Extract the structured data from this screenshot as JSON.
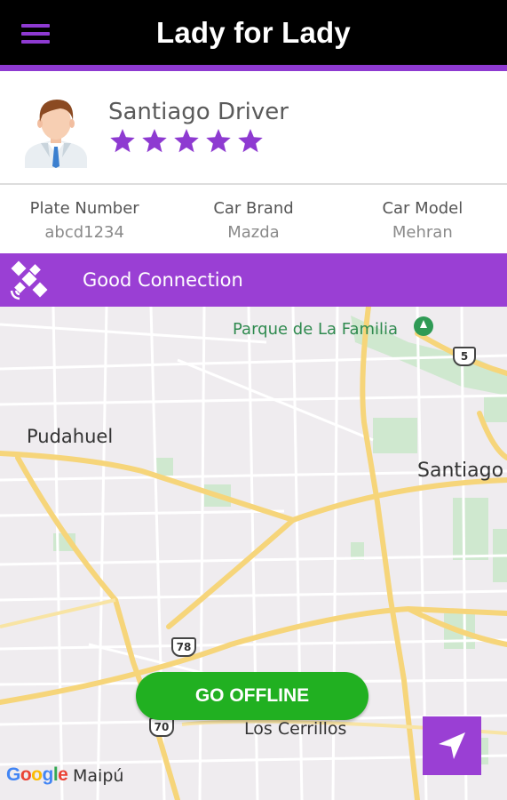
{
  "header": {
    "title": "Lady for Lady",
    "menu_icon": "hamburger-menu-icon"
  },
  "driver": {
    "name": "Santiago Driver",
    "rating": 5,
    "rating_max": 5,
    "avatar_icon": "driver-avatar"
  },
  "vehicle": {
    "plate_label": "Plate Number",
    "plate_value": "abcd1234",
    "brand_label": "Car Brand",
    "brand_value": "Mazda",
    "model_label": "Car Model",
    "model_value": "Mehran"
  },
  "connection": {
    "status": "Good Connection",
    "icon": "satellite-icon"
  },
  "map": {
    "labels": {
      "parque": "Parque de La Familia",
      "pudahuel": "Pudahuel",
      "santiago": "Santiago",
      "cerrillos": "Los Cerrillos",
      "maipu": "Maipú"
    },
    "shields": {
      "r5": "5",
      "r78": "78",
      "r70": "70"
    },
    "attribution": "Google"
  },
  "actions": {
    "go_offline": "GO OFFLINE",
    "navigate_icon": "navigation-arrow-icon"
  },
  "colors": {
    "accent": "#9a3fd4",
    "header_bg": "#000000",
    "offline_green": "#21b021"
  }
}
